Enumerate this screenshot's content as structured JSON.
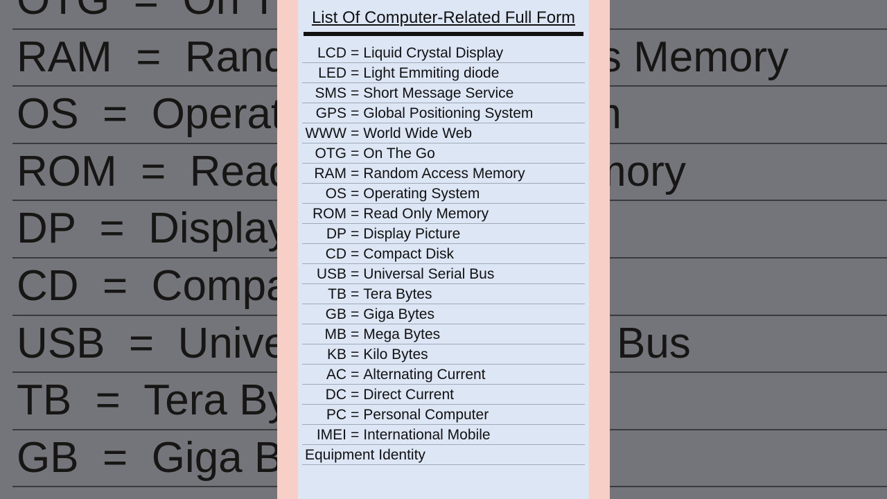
{
  "title": "List Of Computer-Related Full Form",
  "equals": "=",
  "entries": [
    {
      "abbr": "LCD",
      "full": "Liquid Crystal Display"
    },
    {
      "abbr": "LED",
      "full": "Light Emmiting diode"
    },
    {
      "abbr": "SMS",
      "full": "Short Message Service"
    },
    {
      "abbr": "GPS",
      "full": "Global Positioning System"
    },
    {
      "abbr": "WWW",
      "full": "World Wide Web"
    },
    {
      "abbr": "OTG",
      "full": "On The Go"
    },
    {
      "abbr": "RAM",
      "full": "Random Access Memory"
    },
    {
      "abbr": "OS",
      "full": "Operating System"
    },
    {
      "abbr": "ROM",
      "full": "Read Only Memory"
    },
    {
      "abbr": "DP",
      "full": "Display Picture"
    },
    {
      "abbr": "CD",
      "full": "Compact Disk"
    },
    {
      "abbr": "USB",
      "full": "Universal Serial Bus"
    },
    {
      "abbr": "TB",
      "full": "Tera Bytes"
    },
    {
      "abbr": "GB",
      "full": "Giga Bytes"
    },
    {
      "abbr": "MB",
      "full": "Mega Bytes"
    },
    {
      "abbr": "KB",
      "full": "Kilo Bytes"
    },
    {
      "abbr": "AC",
      "full": "Alternating Current"
    },
    {
      "abbr": "DC",
      "full": "Direct Current"
    },
    {
      "abbr": "PC",
      "full": "Personal Computer"
    },
    {
      "abbr": "IMEI",
      "full": "International Mobile",
      "cont": "Equipment Identity"
    }
  ],
  "bg_entries": [
    {
      "abbr": "OTG",
      "full": "On The Go"
    },
    {
      "abbr": "RAM",
      "full": "Random Access Memory"
    },
    {
      "abbr": "OS",
      "full": "Operating System"
    },
    {
      "abbr": "ROM",
      "full": "Read Only Memory"
    },
    {
      "abbr": "DP",
      "full": "Display Picture"
    },
    {
      "abbr": "CD",
      "full": "Compact Disk"
    },
    {
      "abbr": "USB",
      "full": "Universal Serial Bus"
    },
    {
      "abbr": "TB",
      "full": "Tera Bytes"
    },
    {
      "abbr": "GB",
      "full": "Giga Bytes"
    }
  ]
}
